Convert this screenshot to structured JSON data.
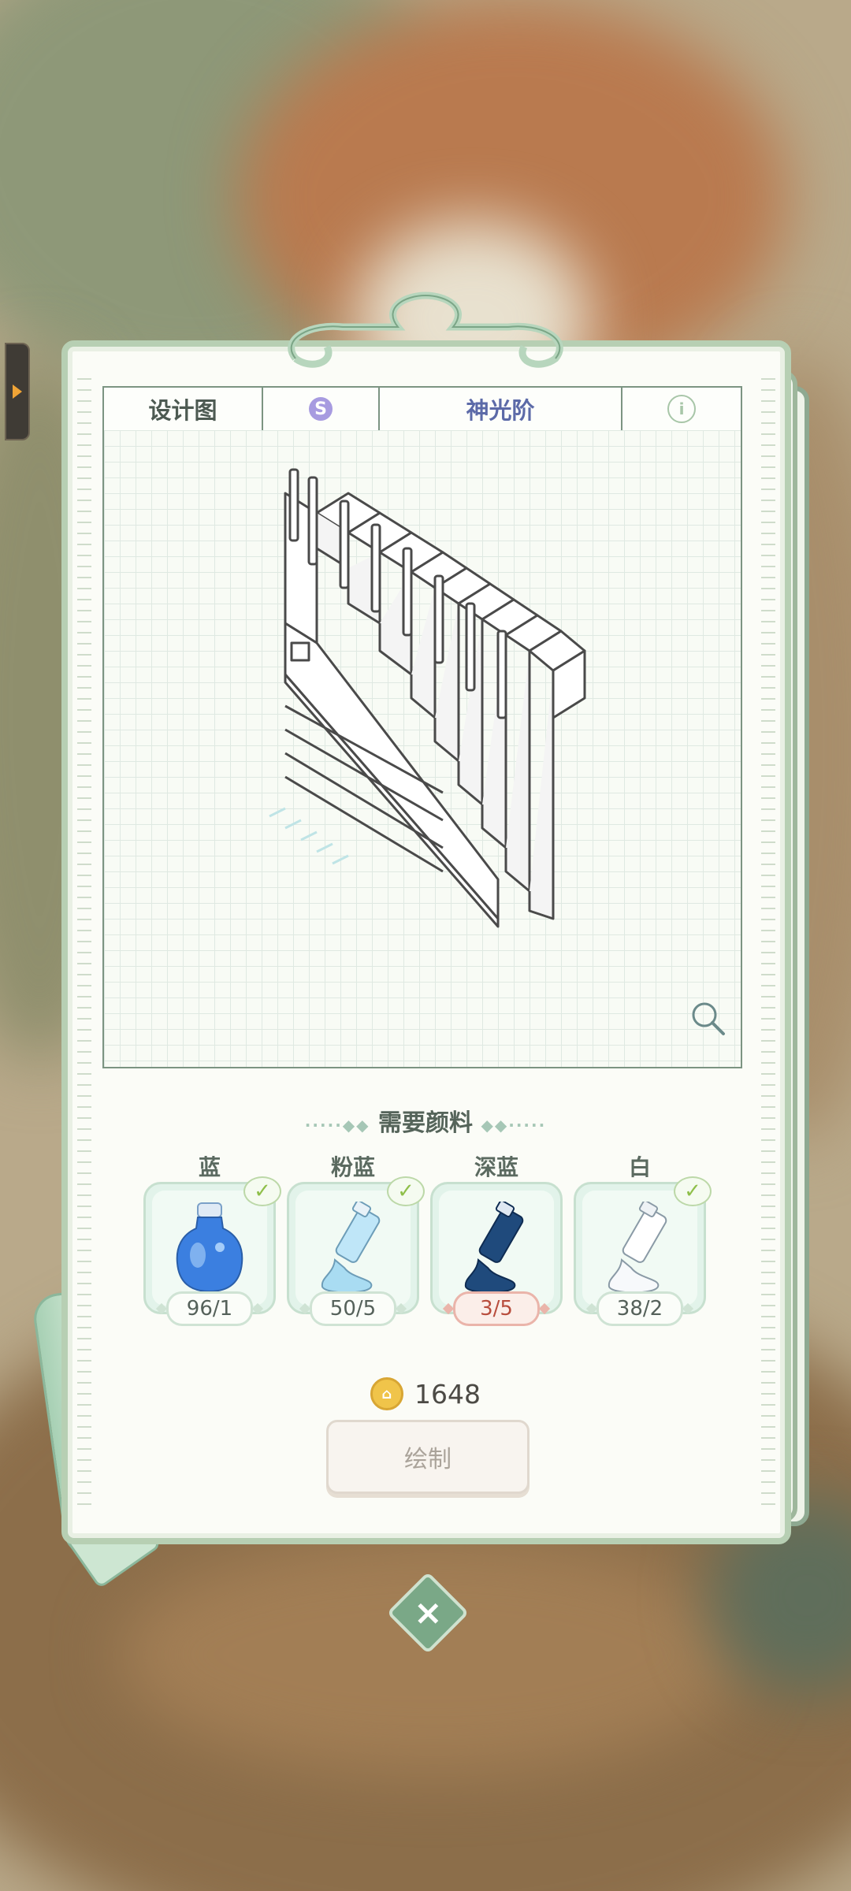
{
  "header": {
    "design_tab": "设计图",
    "tag_letter": "S",
    "item_name": "神光阶"
  },
  "section": {
    "title": "需要颜料",
    "decor_left": "·····◆◆",
    "decor_right": "◆◆·····"
  },
  "pigments": [
    {
      "name": "蓝",
      "count": "96/1",
      "enough": true,
      "icon": "blue-ink-bottle-icon",
      "color": "#3b7fe0"
    },
    {
      "name": "粉蓝",
      "count": "50/5",
      "enough": true,
      "icon": "light-blue-paint-tube-icon",
      "color": "#a9dcf2"
    },
    {
      "name": "深蓝",
      "count": "3/5",
      "enough": false,
      "icon": "dark-blue-paint-tube-icon",
      "color": "#1f4a7c"
    },
    {
      "name": "白",
      "count": "38/2",
      "enough": true,
      "icon": "white-paint-tube-icon",
      "color": "#ffffff"
    }
  ],
  "cost": {
    "value": "1648",
    "icon": "coin-icon"
  },
  "draw_button": "绘制",
  "close_icon": "close-icon"
}
